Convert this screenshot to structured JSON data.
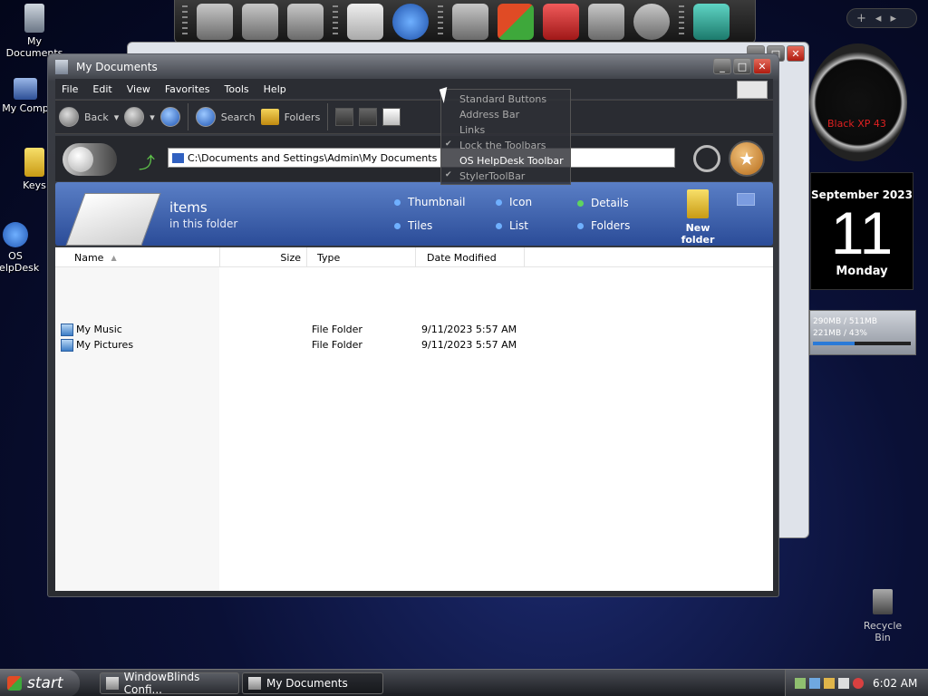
{
  "desktop": {
    "icons": [
      {
        "label": "My Documents"
      },
      {
        "label": "My Comp"
      },
      {
        "label": "Keys"
      },
      {
        "label": "OS HelpDesk"
      }
    ],
    "recycle_bin": "Recycle Bin"
  },
  "widgets": {
    "clock_text": "Black XP 43",
    "calendar_month": "September 2023",
    "calendar_day": "11",
    "calendar_weekday": "Monday",
    "mem_line1": "290MB / 511MB",
    "mem_line2": "221MB / 43%",
    "mem_fraction": 0.43,
    "mini_plus": "+"
  },
  "window": {
    "title": "My Documents",
    "menu": [
      "File",
      "Edit",
      "View",
      "Favorites",
      "Tools",
      "Help"
    ],
    "toolbar": {
      "back": "Back",
      "search": "Search",
      "folders": "Folders"
    },
    "address": "C:\\Documents and Settings\\Admin\\My Documents",
    "banner": {
      "items": "items",
      "in_folder": "in this folder",
      "views": [
        "Thumbnail",
        "Icon",
        "Details",
        "Tiles",
        "List",
        "Folders"
      ],
      "new_folder": "New folder"
    },
    "columns": [
      "Name",
      "Size",
      "Type",
      "Date Modified"
    ],
    "rows": [
      {
        "name": "My Music",
        "size": "",
        "type": "File Folder",
        "modified": "9/11/2023 5:57 AM"
      },
      {
        "name": "My Pictures",
        "size": "",
        "type": "File Folder",
        "modified": "9/11/2023 5:57 AM"
      }
    ]
  },
  "context_menu": {
    "items": [
      {
        "label": "Standard Buttons",
        "checked": false
      },
      {
        "label": "Address Bar",
        "checked": false
      },
      {
        "label": "Links",
        "checked": false
      },
      {
        "label": "Lock the Toolbars",
        "checked": true
      },
      {
        "label": "OS HelpDesk Toolbar",
        "checked": false,
        "highlight": true
      },
      {
        "label": "StylerToolBar",
        "checked": true
      }
    ]
  },
  "taskbar": {
    "start": "start",
    "tasks": [
      "WindowBlinds Confi...",
      "My Documents"
    ],
    "time": "6:02 AM"
  }
}
